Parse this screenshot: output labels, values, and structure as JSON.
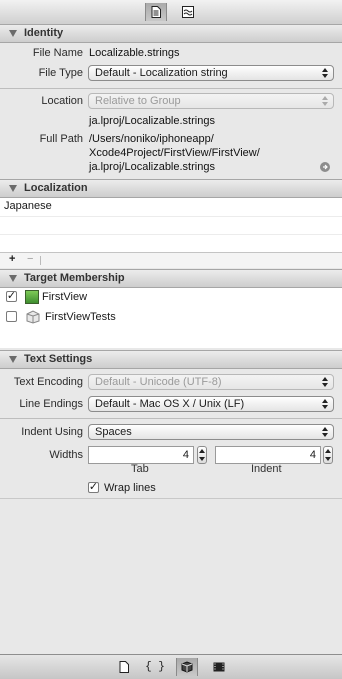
{
  "toolbar": {
    "file_inspector_icon": "file-inspector-icon",
    "quick_help_icon": "quick-help-icon"
  },
  "identity": {
    "header": "Identity",
    "file_name_label": "File Name",
    "file_name": "Localizable.strings",
    "file_type_label": "File Type",
    "file_type": "Default - Localization string",
    "location_label": "Location",
    "location": "Relative to Group",
    "location_path": "ja.lproj/Localizable.strings",
    "full_path_label": "Full Path",
    "full_path_1": "/Users/noniko/iphoneapp/",
    "full_path_2": "Xcode4Project/FirstView/FirstView/",
    "full_path_3": "ja.lproj/Localizable.strings"
  },
  "localization": {
    "header": "Localization",
    "items": [
      "Japanese"
    ],
    "add_label": "+",
    "remove_label": "−"
  },
  "target_membership": {
    "header": "Target Membership",
    "targets": [
      {
        "name": "FirstView",
        "checked": true,
        "check_mark": "✓"
      },
      {
        "name": "FirstViewTests",
        "checked": false,
        "check_mark": ""
      }
    ]
  },
  "text_settings": {
    "header": "Text Settings",
    "text_encoding_label": "Text Encoding",
    "text_encoding": "Default - Unicode (UTF-8)",
    "line_endings_label": "Line Endings",
    "line_endings": "Default - Mac OS X / Unix (LF)",
    "indent_using_label": "Indent Using",
    "indent_using": "Spaces",
    "widths_label": "Widths",
    "tab_value": "4",
    "indent_value": "4",
    "tab_label": "Tab",
    "indent_label": "Indent",
    "wrap_lines_label": "Wrap lines",
    "wrap_lines_check": "✓"
  },
  "bottom_toolbar": {
    "file_template_icon": "file-template-icon",
    "code_snippet_label": "{ }",
    "object_library_icon": "object-library-icon",
    "media_library_icon": "media-library-icon"
  }
}
